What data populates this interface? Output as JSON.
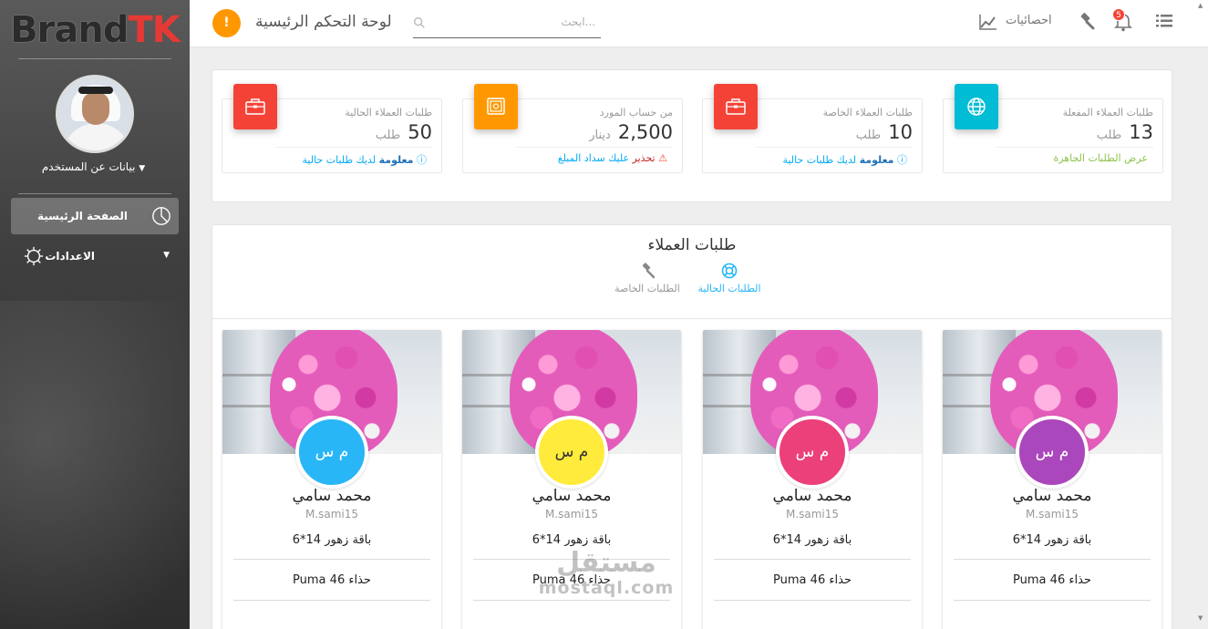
{
  "sidebar": {
    "brand_part1": "Brand",
    "brand_part2": "TK",
    "user_menu_label": "بيانات عن المستخدم",
    "items": [
      {
        "label": "الصفحة الرئيسية",
        "icon": "pie-chart-icon",
        "active": true
      },
      {
        "label": "الاعدادات",
        "icon": "settings-icon",
        "active": false
      }
    ]
  },
  "topbar": {
    "title": "لوحة التحكم الرئيسية",
    "search_placeholder": "...ابحث",
    "stats_label": "احصائيات",
    "notification_count": "5",
    "alert_symbol": "!"
  },
  "stats": [
    {
      "title": "طلبات العملاء المفعلة",
      "value": "13",
      "unit": "طلب",
      "footer_label": "",
      "footer_text": "عرض الطلبات الجاهزة",
      "footer_color": "#8bc34a",
      "icon": "globe-icon",
      "icon_color": "#00bcd4"
    },
    {
      "title": "طلبات العملاء الخاصة",
      "value": "10",
      "unit": "طلب",
      "footer_label": "معلومة",
      "footer_text": "لديك طلبات حالية",
      "footer_color": "#03a9f4",
      "icon": "briefcase-icon",
      "icon_color": "#f44336"
    },
    {
      "title": "من حساب المورد",
      "value": "2,500",
      "unit": "دينار",
      "footer_label": "تحذير",
      "footer_text": "عليك سداد المبلغ",
      "footer_color": "#f44336",
      "icon": "safe-icon",
      "icon_color": "#ff9800"
    },
    {
      "title": "طلبات العملاء الحالية",
      "value": "50",
      "unit": "طلب",
      "footer_label": "معلومة",
      "footer_text": "لديك طلبات حالية",
      "footer_color": "#03a9f4",
      "icon": "briefcase-icon",
      "icon_color": "#f44336"
    }
  ],
  "orders": {
    "title": "طلبات العملاء",
    "tabs": [
      {
        "label": "الطلبات الحالية",
        "icon": "lifebuoy-icon",
        "active": true
      },
      {
        "label": "الطلبات الخاصة",
        "icon": "gavel-icon",
        "active": false
      }
    ],
    "cards": [
      {
        "initials": "م س",
        "name": "محمد سامي",
        "username": "M.sami15",
        "item1": "باقة زهور 14*6",
        "item2": "حذاء 46 Puma",
        "color": "#ab47bc"
      },
      {
        "initials": "م س",
        "name": "محمد سامي",
        "username": "M.sami15",
        "item1": "باقة زهور 14*6",
        "item2": "حذاء 46 Puma",
        "color": "#ec407a"
      },
      {
        "initials": "م س",
        "name": "محمد سامي",
        "username": "M.sami15",
        "item1": "باقة زهور 14*6",
        "item2": "حذاء 46 Puma",
        "color": "#ffeb3b"
      },
      {
        "initials": "م س",
        "name": "محمد سامي",
        "username": "M.sami15",
        "item1": "باقة زهور 14*6",
        "item2": "حذاء 46 Puma",
        "color": "#29b6f6"
      }
    ]
  },
  "watermark": {
    "line1": "مستقل",
    "line2": "mostaql.com"
  }
}
